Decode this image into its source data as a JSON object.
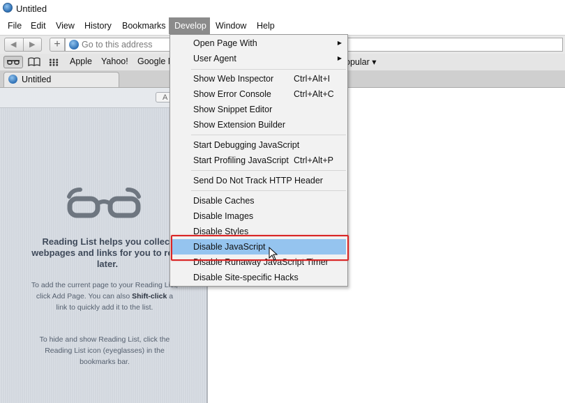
{
  "window": {
    "title": "Untitled"
  },
  "menubar": {
    "items": [
      "File",
      "Edit",
      "View",
      "History",
      "Bookmarks",
      "Develop",
      "Window",
      "Help"
    ],
    "active": "Develop"
  },
  "toolbar": {
    "back_icon": "chevron-left-icon",
    "forward_icon": "chevron-right-icon",
    "add_label": "+",
    "address_placeholder": "Go to this address"
  },
  "bookmarks": {
    "items": [
      "Apple",
      "Yahoo!",
      "Google N",
      "opular ▾"
    ]
  },
  "tabs": [
    {
      "label": "Untitled"
    }
  ],
  "reading_list": {
    "add_page_label": "A",
    "heading": "Reading List helps you collect webpages and links for you to read later.",
    "para1_before": "To add the current page to your Reading List, click Add Page. You can also ",
    "para1_bold": "Shift-click",
    "para1_after": " a link to quickly add it to the list.",
    "para2": "To hide and show Reading List, click the Reading List icon (eyeglasses) in the bookmarks bar."
  },
  "develop_menu": {
    "items": [
      {
        "label": "Open Page With",
        "shortcut": "",
        "submenu": true
      },
      {
        "label": "User Agent",
        "shortcut": "",
        "submenu": true
      },
      {
        "label": "Show Web Inspector",
        "shortcut": "Ctrl+Alt+I"
      },
      {
        "label": "Show Error Console",
        "shortcut": "Ctrl+Alt+C"
      },
      {
        "label": "Show Snippet Editor",
        "shortcut": ""
      },
      {
        "label": "Show Extension Builder",
        "shortcut": ""
      },
      {
        "label": "Start Debugging JavaScript",
        "shortcut": ""
      },
      {
        "label": "Start Profiling JavaScript",
        "shortcut": "Ctrl+Alt+P"
      },
      {
        "label": "Send Do Not Track HTTP Header",
        "shortcut": ""
      },
      {
        "label": "Disable Caches",
        "shortcut": ""
      },
      {
        "label": "Disable Images",
        "shortcut": ""
      },
      {
        "label": "Disable Styles",
        "shortcut": ""
      },
      {
        "label": "Disable JavaScript",
        "shortcut": "",
        "highlighted": true
      },
      {
        "label": "Disable Runaway JavaScript Timer",
        "shortcut": ""
      },
      {
        "label": "Disable Site-specific Hacks",
        "shortcut": ""
      }
    ],
    "submenu_glyph": "▶"
  },
  "colors": {
    "menu_highlight": "#95c4ef",
    "annotation_box": "#d92424",
    "active_menu": "#8b8b8b"
  }
}
